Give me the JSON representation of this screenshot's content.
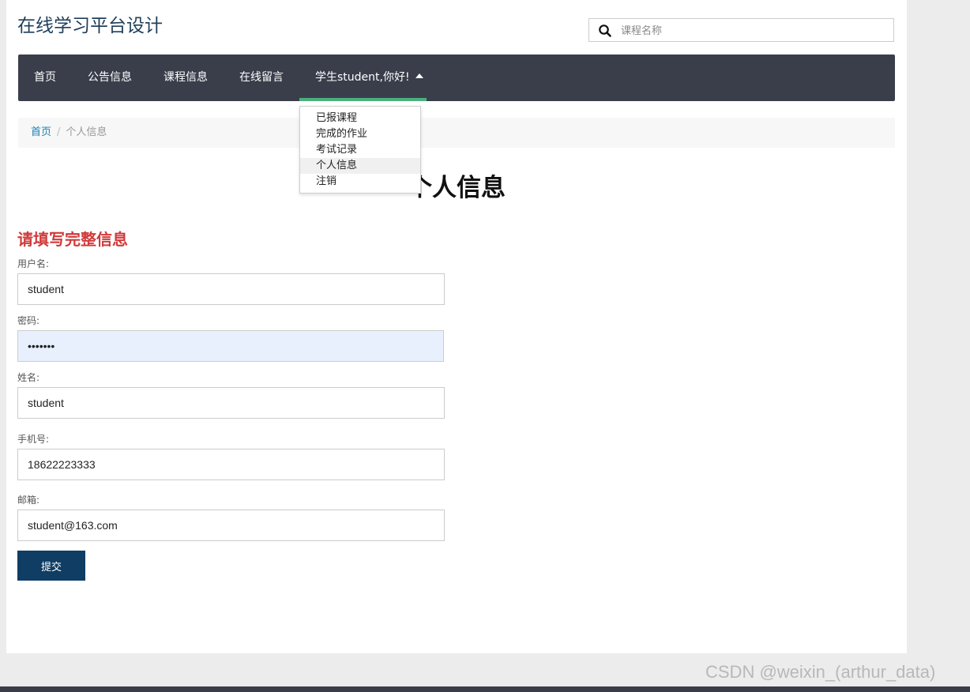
{
  "header": {
    "site_title": "在线学习平台设计",
    "search": {
      "placeholder": "课程名称",
      "value": ""
    }
  },
  "navbar": {
    "items": [
      {
        "label": "首页"
      },
      {
        "label": "公告信息"
      },
      {
        "label": "课程信息"
      },
      {
        "label": "在线留言"
      },
      {
        "label": "学生student,你好!"
      }
    ],
    "accent_color": "#4caf7d"
  },
  "user_dropdown": {
    "items": [
      {
        "label": "已报课程"
      },
      {
        "label": "完成的作业"
      },
      {
        "label": "考试记录"
      },
      {
        "label": "个人信息"
      },
      {
        "label": "注销"
      }
    ]
  },
  "breadcrumb": {
    "home": "首页",
    "separator": "/",
    "current": "个人信息"
  },
  "page": {
    "heading": "个人信息"
  },
  "form": {
    "heading": "请填写完整信息",
    "fields": [
      {
        "label": "用户名:",
        "value": "student"
      },
      {
        "label": "密码:",
        "value": "•••••••"
      },
      {
        "label": "姓名:",
        "value": "student"
      },
      {
        "label": "手机号:",
        "value": "18622223333"
      },
      {
        "label": "邮箱:",
        "value": "student@163.com"
      }
    ],
    "submit_label": "提交"
  },
  "watermark": "CSDN @weixin_(arthur_data)",
  "colors": {
    "navbar_bg": "#3a3e4b",
    "title": "#1f3f5b",
    "form_heading": "#d03b3b",
    "button": "#0f3d63"
  }
}
